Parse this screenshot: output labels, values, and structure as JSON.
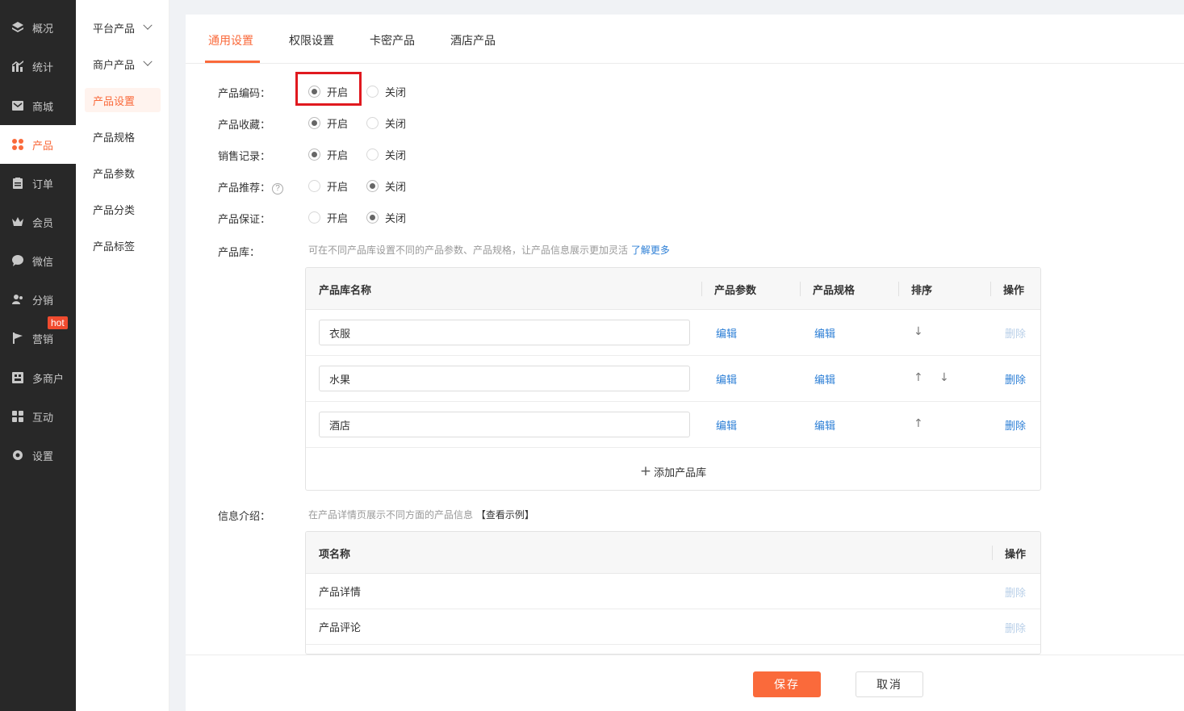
{
  "nav": {
    "items": [
      {
        "label": "概况",
        "icon": "layers-icon"
      },
      {
        "label": "统计",
        "icon": "chart-icon"
      },
      {
        "label": "商城",
        "icon": "mail-icon"
      },
      {
        "label": "产品",
        "icon": "grid-icon"
      },
      {
        "label": "订单",
        "icon": "clipboard-icon"
      },
      {
        "label": "会员",
        "icon": "crown-icon"
      },
      {
        "label": "微信",
        "icon": "chat-icon"
      },
      {
        "label": "分销",
        "icon": "users-icon"
      },
      {
        "label": "营销",
        "icon": "flag-icon"
      },
      {
        "label": "多商户",
        "icon": "store-icon"
      },
      {
        "label": "互动",
        "icon": "apps-icon"
      },
      {
        "label": "设置",
        "icon": "gear-icon"
      }
    ],
    "hot_badge": "hot",
    "active_index": 3
  },
  "subnav": {
    "items": [
      "平台产品",
      "商户产品",
      "产品设置",
      "产品规格",
      "产品参数",
      "产品分类",
      "产品标签"
    ]
  },
  "tabs": [
    "通用设置",
    "权限设置",
    "卡密产品",
    "酒店产品"
  ],
  "settings": [
    {
      "label": "产品编码：",
      "on": "开启",
      "off": "关闭",
      "value": "on"
    },
    {
      "label": "产品收藏：",
      "on": "开启",
      "off": "关闭",
      "value": "on"
    },
    {
      "label": "销售记录：",
      "on": "开启",
      "off": "关闭",
      "value": "on"
    },
    {
      "label": "产品推荐：",
      "on": "开启",
      "off": "关闭",
      "value": "off"
    },
    {
      "label": "产品保证：",
      "on": "开启",
      "off": "关闭",
      "value": "off"
    }
  ],
  "library": {
    "label": "产品库：",
    "hint": "可在不同产品库设置不同的产品参数、产品规格，让产品信息展示更加灵活",
    "hint_link": "了解更多",
    "columns": [
      "产品库名称",
      "产品参数",
      "产品规格",
      "排序",
      "操作"
    ],
    "rows": [
      {
        "name": "衣服",
        "param": "编辑",
        "spec": "编辑",
        "up": false,
        "down": true,
        "del": "删除",
        "del_enabled": false
      },
      {
        "name": "水果",
        "param": "编辑",
        "spec": "编辑",
        "up": true,
        "down": true,
        "del": "删除",
        "del_enabled": true
      },
      {
        "name": "酒店",
        "param": "编辑",
        "spec": "编辑",
        "up": true,
        "down": false,
        "del": "删除",
        "del_enabled": true
      }
    ],
    "add_label": "添加产品库"
  },
  "info": {
    "label": "信息介绍：",
    "hint": "在产品详情页展示不同方面的产品信息",
    "hint_link": "【查看示例】",
    "columns": [
      "项名称",
      "操作"
    ],
    "rows": [
      {
        "name": "产品详情",
        "del": "删除"
      },
      {
        "name": "产品评论",
        "del": "删除"
      }
    ]
  },
  "footer": {
    "save": "保存",
    "cancel": "取消"
  },
  "colors": {
    "accent": "#fa6a3b",
    "link": "#2d7fd6",
    "sidebar": "#282828"
  }
}
